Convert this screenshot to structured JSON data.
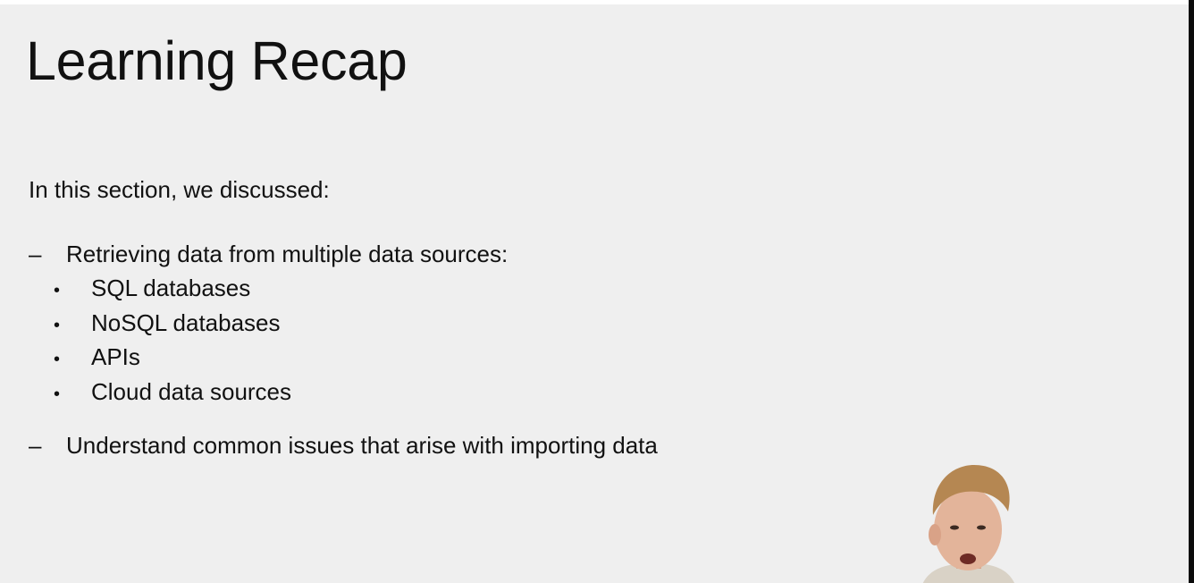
{
  "slide": {
    "title": "Learning Recap",
    "intro": "In this section, we discussed:",
    "points": [
      {
        "marker": "–",
        "text": "Retrieving data from multiple data sources:",
        "subpoints": [
          "SQL databases",
          "NoSQL databases",
          "APIs",
          "Cloud data sources"
        ]
      },
      {
        "marker": "–",
        "text": "Understand common issues that arise with importing data"
      }
    ],
    "sub_marker": "•"
  },
  "colors": {
    "slide_background": "#efefef",
    "text": "#111111",
    "edge": "#0b0b0b"
  },
  "icons": {
    "presenter": "presenter-webcam-overlay"
  }
}
